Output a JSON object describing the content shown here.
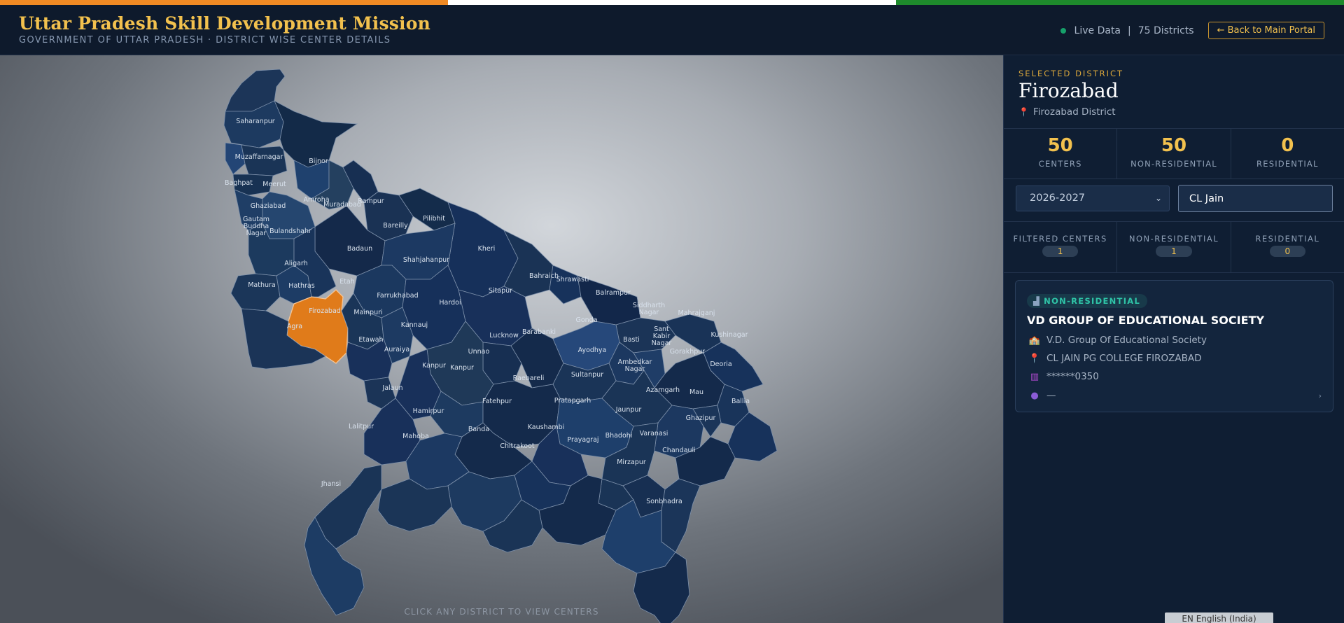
{
  "header": {
    "title": "Uttar Pradesh Skill Development Mission",
    "subtitle": "GOVERNMENT OF UTTAR PRADESH · DISTRICT WISE CENTER DETAILS",
    "live_label": "Live Data",
    "separator": "|",
    "districts_count": "75 Districts",
    "back_button": "← Back to Main Portal"
  },
  "colors": {
    "accent": "#f2c14e",
    "selected_district": "#e07b1a",
    "district_fill": "#1b3556",
    "live": "#16a06a",
    "badge_text": "#2fc5a8"
  },
  "map": {
    "hint": "CLICK ANY DISTRICT TO VIEW CENTERS",
    "selected": "Firozabad",
    "districts": [
      {
        "name": "Saharanpur"
      },
      {
        "name": "Muzaffarnagar"
      },
      {
        "name": "Bijnor"
      },
      {
        "name": "Baghpat"
      },
      {
        "name": "Meerut"
      },
      {
        "name": "Amroha"
      },
      {
        "name": "Muradabad"
      },
      {
        "name": "Rampur"
      },
      {
        "name": "Ghaziabad"
      },
      {
        "name": "Gautam Buddha Nagar"
      },
      {
        "name": "Bulandshahr"
      },
      {
        "name": "Bareilly"
      },
      {
        "name": "Pilibhit"
      },
      {
        "name": "Badaun"
      },
      {
        "name": "Kheri"
      },
      {
        "name": "Shahjahanpur"
      },
      {
        "name": "Aligarh"
      },
      {
        "name": "Mathura"
      },
      {
        "name": "Hathras"
      },
      {
        "name": "Etah"
      },
      {
        "name": "Bahraich"
      },
      {
        "name": "Shrawasti"
      },
      {
        "name": "Sitapur"
      },
      {
        "name": "Farrukhabad"
      },
      {
        "name": "Hardoi"
      },
      {
        "name": "Balrampur"
      },
      {
        "name": "Firozabad"
      },
      {
        "name": "Mainpuri"
      },
      {
        "name": "Agra"
      },
      {
        "name": "Siddharth Nagar"
      },
      {
        "name": "Mahrajganj"
      },
      {
        "name": "Kannauj"
      },
      {
        "name": "Etawah"
      },
      {
        "name": "Lucknow"
      },
      {
        "name": "Barabanki"
      },
      {
        "name": "Gonda"
      },
      {
        "name": "Basti"
      },
      {
        "name": "Sant Kabir Nagar"
      },
      {
        "name": "Kushinagar"
      },
      {
        "name": "Auraiya"
      },
      {
        "name": "Unnao"
      },
      {
        "name": "Ayodhya"
      },
      {
        "name": "Gorakhpur"
      },
      {
        "name": "Kanpur"
      },
      {
        "name": "Kanpur"
      },
      {
        "name": "Ambedkar Nagar"
      },
      {
        "name": "Deoria"
      },
      {
        "name": "Raebareli"
      },
      {
        "name": "Sultanpur"
      },
      {
        "name": "Jalaun"
      },
      {
        "name": "Azamgarh"
      },
      {
        "name": "Mau"
      },
      {
        "name": "Fatehpur"
      },
      {
        "name": "Ballia"
      },
      {
        "name": "Pratapgarh"
      },
      {
        "name": "Hamirpur"
      },
      {
        "name": "Jaunpur"
      },
      {
        "name": "Ghazipur"
      },
      {
        "name": "Lalitpur"
      },
      {
        "name": "Kaushambi"
      },
      {
        "name": "Banda"
      },
      {
        "name": "Mahoba"
      },
      {
        "name": "Bhadohi"
      },
      {
        "name": "Varanasi"
      },
      {
        "name": "Prayagraj"
      },
      {
        "name": "Chitrakoot"
      },
      {
        "name": "Chandauli"
      },
      {
        "name": "Mirzapur"
      },
      {
        "name": "Jhansi"
      },
      {
        "name": "Sonbhadra"
      }
    ]
  },
  "panel": {
    "selected_label": "SELECTED DISTRICT",
    "district_name": "Firozabad",
    "district_sub": "Firozabad District",
    "stats": [
      {
        "value": "50",
        "label": "CENTERS"
      },
      {
        "value": "50",
        "label": "NON-RESIDENTIAL"
      },
      {
        "value": "0",
        "label": "RESIDENTIAL"
      }
    ],
    "year_select": "2026-2027",
    "search_value": "CL Jain",
    "filtered": [
      {
        "label": "FILTERED CENTERS",
        "value": "1"
      },
      {
        "label": "NON-RESIDENTIAL",
        "value": "1"
      },
      {
        "label": "RESIDENTIAL",
        "value": "0"
      }
    ],
    "card": {
      "badge": "NON-RESIDENTIAL",
      "title": "VD GROUP OF EDUCATIONAL SOCIETY",
      "society": "V.D. Group Of Educational Society",
      "location": "CL JAIN PG COLLEGE FIROZABAD",
      "phone": "******0350",
      "contact": "—"
    },
    "language": "EN English (India)"
  }
}
